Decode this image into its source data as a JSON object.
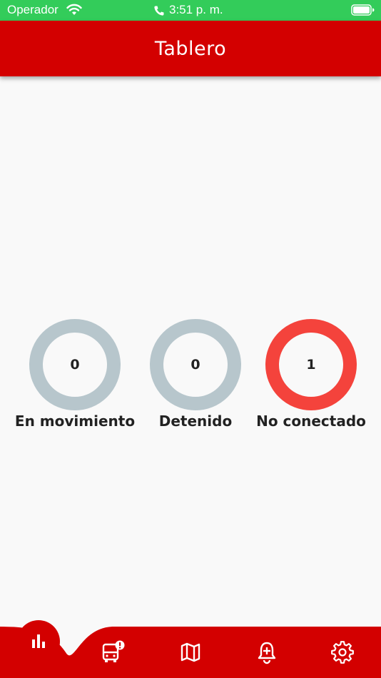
{
  "status_bar": {
    "carrier": "Operador",
    "time": "3:51 p. m.",
    "icons": [
      "wifi-icon",
      "phone-icon",
      "battery-icon"
    ]
  },
  "header": {
    "title": "Tablero"
  },
  "stats": [
    {
      "label": "En movimiento",
      "count": "0",
      "color": "#b7c6cc"
    },
    {
      "label": "Detenido",
      "count": "0",
      "color": "#b7c6cc"
    },
    {
      "label": "No conectado",
      "count": "1",
      "color": "#f4433c"
    }
  ],
  "bottom_nav": {
    "items": [
      {
        "icon": "bar-chart-icon",
        "active": true
      },
      {
        "icon": "bus-alert-icon",
        "active": false
      },
      {
        "icon": "map-icon",
        "active": false
      },
      {
        "icon": "bell-plus-icon",
        "active": false
      },
      {
        "icon": "gear-icon",
        "active": false
      }
    ]
  },
  "colors": {
    "primary": "#d30000",
    "status_bar": "#33cc5a",
    "inactive_ring": "#b7c6cc",
    "alert_ring": "#f4433c",
    "background": "#f9f9f9"
  }
}
